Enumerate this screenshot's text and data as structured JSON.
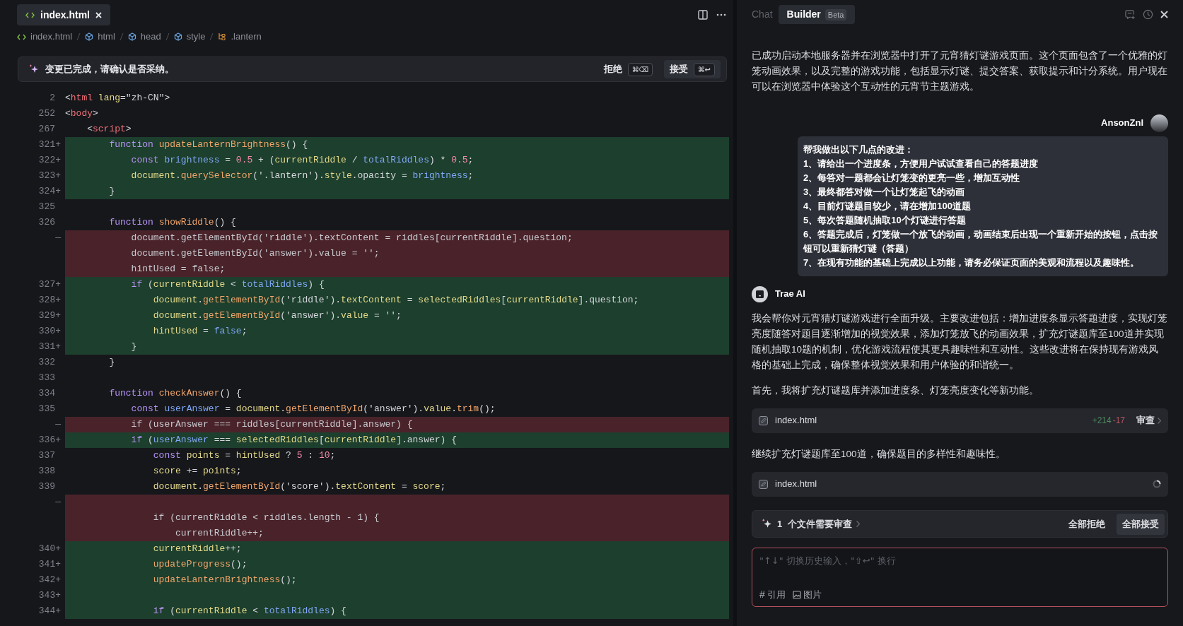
{
  "editor": {
    "tab": {
      "label": "index.html",
      "selected": true
    },
    "breadcrumb": [
      {
        "label": "index.html",
        "kind": "file"
      },
      {
        "label": "html",
        "kind": "element"
      },
      {
        "label": "head",
        "kind": "element"
      },
      {
        "label": "style",
        "kind": "element"
      },
      {
        "label": ".lantern",
        "kind": "selector"
      }
    ],
    "notice": {
      "message": "变更已完成，请确认是否采纳。",
      "buttons": [
        {
          "label": "拒绝",
          "shortcut": "⌘⌫",
          "primary": false
        },
        {
          "label": "接受",
          "shortcut": "⌘↩",
          "primary": true
        }
      ]
    },
    "lines": [
      {
        "no": "2",
        "kind": "context",
        "tokens": [
          {
            "kind": "plain",
            "text": "<"
          },
          {
            "kind": "tag",
            "text": "html"
          },
          {
            "kind": "attr",
            "text": " lang"
          },
          {
            "kind": "plain",
            "text": "=\"zh-CN\">"
          }
        ]
      },
      {
        "no": "252",
        "kind": "context",
        "tokens": [
          {
            "kind": "plain",
            "text": "<"
          },
          {
            "kind": "tag",
            "text": "body"
          },
          {
            "kind": "plain",
            "text": ">"
          }
        ]
      },
      {
        "no": "267",
        "kind": "context",
        "tokens": [
          {
            "kind": "plain",
            "text": "    <"
          },
          {
            "kind": "tag",
            "text": "script"
          },
          {
            "kind": "plain",
            "text": ">"
          }
        ]
      },
      {
        "no": "321+",
        "kind": "added",
        "tokens": [
          {
            "kind": "keyword",
            "text": "        function "
          },
          {
            "kind": "func",
            "text": "updateLanternBrightness"
          },
          {
            "kind": "plain",
            "text": "() {"
          }
        ]
      },
      {
        "no": "322+",
        "kind": "added",
        "tokens": [
          {
            "kind": "keyword",
            "text": "            const "
          },
          {
            "kind": "name",
            "text": "brightness"
          },
          {
            "kind": "plain",
            "text": " = "
          },
          {
            "kind": "number",
            "text": "0.5"
          },
          {
            "kind": "plain",
            "text": " + ("
          },
          {
            "kind": "var",
            "text": "currentRiddle"
          },
          {
            "kind": "plain",
            "text": " / "
          },
          {
            "kind": "name",
            "text": "totalRiddles"
          },
          {
            "kind": "plain",
            "text": ") * "
          },
          {
            "kind": "number",
            "text": "0.5"
          },
          {
            "kind": "plain",
            "text": ";"
          }
        ]
      },
      {
        "no": "323+",
        "kind": "added",
        "tokens": [
          {
            "kind": "var",
            "text": "            document"
          },
          {
            "kind": "plain",
            "text": "."
          },
          {
            "kind": "func",
            "text": "querySelector"
          },
          {
            "kind": "plain",
            "text": "('.lantern')."
          },
          {
            "kind": "var",
            "text": "style"
          },
          {
            "kind": "plain",
            "text": ".opacity = "
          },
          {
            "kind": "name",
            "text": "brightness"
          },
          {
            "kind": "plain",
            "text": ";"
          }
        ]
      },
      {
        "no": "324+",
        "kind": "added",
        "tokens": [
          {
            "kind": "plain",
            "text": "        }"
          }
        ]
      },
      {
        "no": "325",
        "kind": "context"
      },
      {
        "no": "326",
        "kind": "context",
        "tokens": [
          {
            "kind": "keyword",
            "text": "        function "
          },
          {
            "kind": "func",
            "text": "showRiddle"
          },
          {
            "kind": "plain",
            "text": "() {"
          }
        ]
      },
      {
        "no": "—",
        "kind": "removed",
        "text": "            document.getElementById('riddle').textContent = riddles[currentRiddle].question;"
      },
      {
        "kind": "removed",
        "text": "            document.getElementById('answer').value = '';"
      },
      {
        "kind": "removed",
        "text": "            hintUsed = false;"
      },
      {
        "no": "327+",
        "kind": "added",
        "tokens": [
          {
            "kind": "keyword",
            "text": "            if"
          },
          {
            "kind": "plain",
            "text": " ("
          },
          {
            "kind": "var",
            "text": "currentRiddle"
          },
          {
            "kind": "plain",
            "text": " < "
          },
          {
            "kind": "name",
            "text": "totalRiddles"
          },
          {
            "kind": "plain",
            "text": ") {"
          }
        ]
      },
      {
        "no": "328+",
        "kind": "added",
        "tokens": [
          {
            "kind": "var",
            "text": "                document"
          },
          {
            "kind": "plain",
            "text": "."
          },
          {
            "kind": "func",
            "text": "getElementById"
          },
          {
            "kind": "plain",
            "text": "('riddle')."
          },
          {
            "kind": "var",
            "text": "textContent"
          },
          {
            "kind": "plain",
            "text": " = "
          },
          {
            "kind": "var",
            "text": "selectedRiddles"
          },
          {
            "kind": "plain",
            "text": "["
          },
          {
            "kind": "var",
            "text": "currentRiddle"
          },
          {
            "kind": "plain",
            "text": "].question;"
          }
        ]
      },
      {
        "no": "329+",
        "kind": "added",
        "tokens": [
          {
            "kind": "var",
            "text": "                document"
          },
          {
            "kind": "plain",
            "text": "."
          },
          {
            "kind": "func",
            "text": "getElementById"
          },
          {
            "kind": "plain",
            "text": "('answer')."
          },
          {
            "kind": "var",
            "text": "value"
          },
          {
            "kind": "plain",
            "text": " = '';"
          }
        ]
      },
      {
        "no": "330+",
        "kind": "added",
        "tokens": [
          {
            "kind": "var",
            "text": "                hintUsed"
          },
          {
            "kind": "plain",
            "text": " = "
          },
          {
            "kind": "name",
            "text": "false"
          },
          {
            "kind": "plain",
            "text": ";"
          }
        ]
      },
      {
        "no": "331+",
        "kind": "added",
        "tokens": [
          {
            "kind": "plain",
            "text": "            }"
          }
        ]
      },
      {
        "no": "332",
        "kind": "context",
        "tokens": [
          {
            "kind": "plain",
            "text": "        }"
          }
        ]
      },
      {
        "no": "333",
        "kind": "context"
      },
      {
        "no": "334",
        "kind": "context",
        "tokens": [
          {
            "kind": "keyword",
            "text": "        function "
          },
          {
            "kind": "func",
            "text": "checkAnswer"
          },
          {
            "kind": "plain",
            "text": "() {"
          }
        ]
      },
      {
        "no": "335",
        "kind": "context",
        "tokens": [
          {
            "kind": "keyword",
            "text": "            const "
          },
          {
            "kind": "name",
            "text": "userAnswer"
          },
          {
            "kind": "plain",
            "text": " = "
          },
          {
            "kind": "var",
            "text": "document"
          },
          {
            "kind": "plain",
            "text": "."
          },
          {
            "kind": "func",
            "text": "getElementById"
          },
          {
            "kind": "plain",
            "text": "('answer')."
          },
          {
            "kind": "var",
            "text": "value"
          },
          {
            "kind": "plain",
            "text": "."
          },
          {
            "kind": "func",
            "text": "trim"
          },
          {
            "kind": "plain",
            "text": "();"
          }
        ]
      },
      {
        "no": "—",
        "kind": "removed",
        "text": "            if (userAnswer === riddles[currentRiddle].answer) {"
      },
      {
        "no": "336+",
        "kind": "added",
        "tokens": [
          {
            "kind": "keyword",
            "text": "            if"
          },
          {
            "kind": "plain",
            "text": " ("
          },
          {
            "kind": "name",
            "text": "userAnswer"
          },
          {
            "kind": "plain",
            "text": " === "
          },
          {
            "kind": "var",
            "text": "selectedRiddles"
          },
          {
            "kind": "plain",
            "text": "["
          },
          {
            "kind": "var",
            "text": "currentRiddle"
          },
          {
            "kind": "plain",
            "text": "].answer) {"
          }
        ]
      },
      {
        "no": "337",
        "kind": "context",
        "tokens": [
          {
            "kind": "keyword",
            "text": "                const "
          },
          {
            "kind": "var",
            "text": "points"
          },
          {
            "kind": "plain",
            "text": " = "
          },
          {
            "kind": "var",
            "text": "hintUsed"
          },
          {
            "kind": "plain",
            "text": " ? "
          },
          {
            "kind": "number",
            "text": "5"
          },
          {
            "kind": "plain",
            "text": " : "
          },
          {
            "kind": "number",
            "text": "10"
          },
          {
            "kind": "plain",
            "text": ";"
          }
        ]
      },
      {
        "no": "338",
        "kind": "context",
        "tokens": [
          {
            "kind": "var",
            "text": "                score"
          },
          {
            "kind": "plain",
            "text": " += "
          },
          {
            "kind": "var",
            "text": "points"
          },
          {
            "kind": "plain",
            "text": ";"
          }
        ]
      },
      {
        "no": "339",
        "kind": "context",
        "tokens": [
          {
            "kind": "var",
            "text": "                document"
          },
          {
            "kind": "plain",
            "text": "."
          },
          {
            "kind": "func",
            "text": "getElementById"
          },
          {
            "kind": "plain",
            "text": "('score')."
          },
          {
            "kind": "var",
            "text": "textContent"
          },
          {
            "kind": "plain",
            "text": " = "
          },
          {
            "kind": "var",
            "text": "score"
          },
          {
            "kind": "plain",
            "text": ";"
          }
        ]
      },
      {
        "no": "—",
        "kind": "removed"
      },
      {
        "kind": "removed",
        "text": "                if (currentRiddle < riddles.length - 1) {"
      },
      {
        "kind": "removed",
        "text": "                    currentRiddle++;"
      },
      {
        "no": "340+",
        "kind": "added",
        "tokens": [
          {
            "kind": "var",
            "text": "                currentRiddle"
          },
          {
            "kind": "plain",
            "text": "++;"
          }
        ]
      },
      {
        "no": "341+",
        "kind": "added",
        "tokens": [
          {
            "kind": "func",
            "text": "                updateProgress"
          },
          {
            "kind": "plain",
            "text": "();"
          }
        ]
      },
      {
        "no": "342+",
        "kind": "added",
        "tokens": [
          {
            "kind": "func",
            "text": "                updateLanternBrightness"
          },
          {
            "kind": "plain",
            "text": "();"
          }
        ]
      },
      {
        "no": "343+",
        "kind": "added"
      },
      {
        "no": "344+",
        "kind": "added",
        "tokens": [
          {
            "kind": "keyword",
            "text": "                if"
          },
          {
            "kind": "plain",
            "text": " ("
          },
          {
            "kind": "var",
            "text": "currentRiddle"
          },
          {
            "kind": "plain",
            "text": " < "
          },
          {
            "kind": "name",
            "text": "totalRiddles"
          },
          {
            "kind": "plain",
            "text": ") {"
          }
        ]
      }
    ]
  },
  "assistant": {
    "tabs": [
      {
        "label": "Chat",
        "selected": false
      },
      {
        "label": "Builder",
        "selected": true,
        "badge": "Beta"
      }
    ],
    "messages": [
      {
        "kind": "text",
        "text": "已成功启动本地服务器并在浏览器中打开了元宵猜灯谜游戏页面。这个页面包含了一个优雅的灯笼动画效果，以及完整的游戏功能，包括显示灯谜、提交答案、获取提示和计分系统。用户现在可以在浏览器中体验这个互动性的元宵节主题游戏。"
      },
      {
        "kind": "user",
        "author": "AnsonZnl",
        "lines": [
          "帮我做出以下几点的改进：",
          "1、请给出一个进度条，方便用户试试查看自己的答题进度",
          "2、每答对一题都会让灯笼变的更亮一些，增加互动性",
          "3、最终都答对做一个让灯笼起飞的动画",
          "4、目前灯谜题目较少，请在增加100道题",
          "5、每次答题随机抽取10个灯谜进行答题",
          "6、答题完成后，灯笼做一个放飞的动画，动画结束后出现一个重新开始的按钮，点击按钮可以重新猜灯谜（答题）",
          "7、在现有功能的基础上完成以上功能，请务必保证页面的美观和流程以及趣味性。"
        ]
      },
      {
        "kind": "ai",
        "author": "Trae AI"
      },
      {
        "kind": "text",
        "text": "我会帮你对元宵猜灯谜游戏进行全面升级。主要改进包括：增加进度条显示答题进度，实现灯笼亮度随答对题目逐渐增加的视觉效果，添加灯笼放飞的动画效果，扩充灯谜题库至100道并实现随机抽取10题的机制，优化游戏流程使其更具趣味性和互动性。这些改进将在保持现有游戏风格的基础上完成，确保整体视觉效果和用户体验的和谐统一。"
      },
      {
        "kind": "text",
        "text": "首先，我将扩充灯谜题库并添加进度条、灯笼亮度变化等新功能。"
      },
      {
        "kind": "file",
        "name": "index.html",
        "added": "+214",
        "removed": "-17",
        "action": "审查",
        "loading": false
      },
      {
        "kind": "text",
        "text": "继续扩充灯谜题库至100道，确保题目的多样性和趣味性。"
      },
      {
        "kind": "file",
        "name": "index.html",
        "loading": true
      }
    ],
    "review_bar": {
      "count": "1",
      "label": "个文件需要审查",
      "reject": "全部拒绝",
      "accept": "全部接受"
    },
    "input": {
      "placeholder": "\"↑↓\" 切换历史输入，\"⇧↩\" 换行",
      "tools": [
        {
          "kind": "hash",
          "glyph": "#",
          "label": "引用"
        },
        {
          "kind": "image",
          "label": "图片"
        }
      ]
    }
  }
}
